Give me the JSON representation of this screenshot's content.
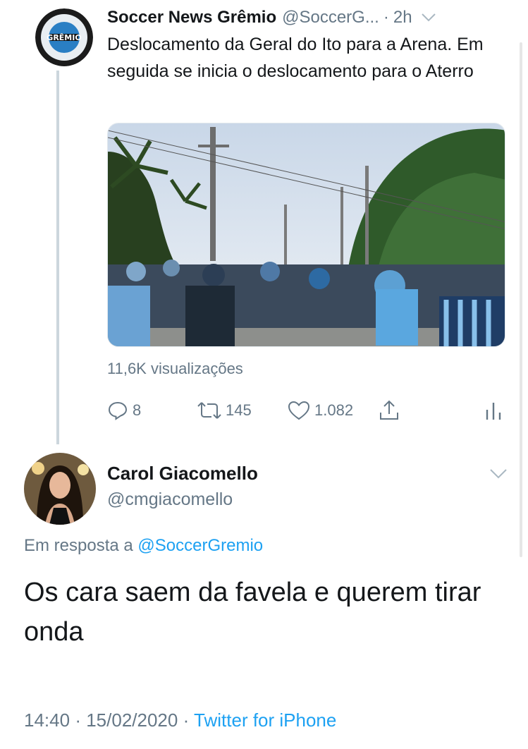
{
  "parent_tweet": {
    "author_name": "Soccer News Grêmio",
    "author_handle": "@SoccerG...",
    "separator": "·",
    "time_ago": "2h",
    "text": "Deslocamento da Geral do Ito para a Arena. Em seguida se inicia o deslocamento para o Aterro",
    "views": "11,6K visualizações",
    "actions": {
      "replies": "8",
      "retweets": "145",
      "likes": "1.082"
    },
    "avatar_text": "GRÊMIO"
  },
  "reply_tweet": {
    "author_name": "Carol Giacomello",
    "author_handle": "@cmgiacomello",
    "replying_prefix": "Em resposta a",
    "replying_to": "@SoccerGremio",
    "text": "Os cara saem da favela e querem tirar onda",
    "time": "14:40",
    "separator1": "·",
    "date": "15/02/2020",
    "separator2": "·",
    "source": "Twitter for iPhone"
  },
  "colors": {
    "text": "#14171a",
    "secondary": "#657786",
    "link": "#1da1f2",
    "border": "#e1e8ed"
  }
}
